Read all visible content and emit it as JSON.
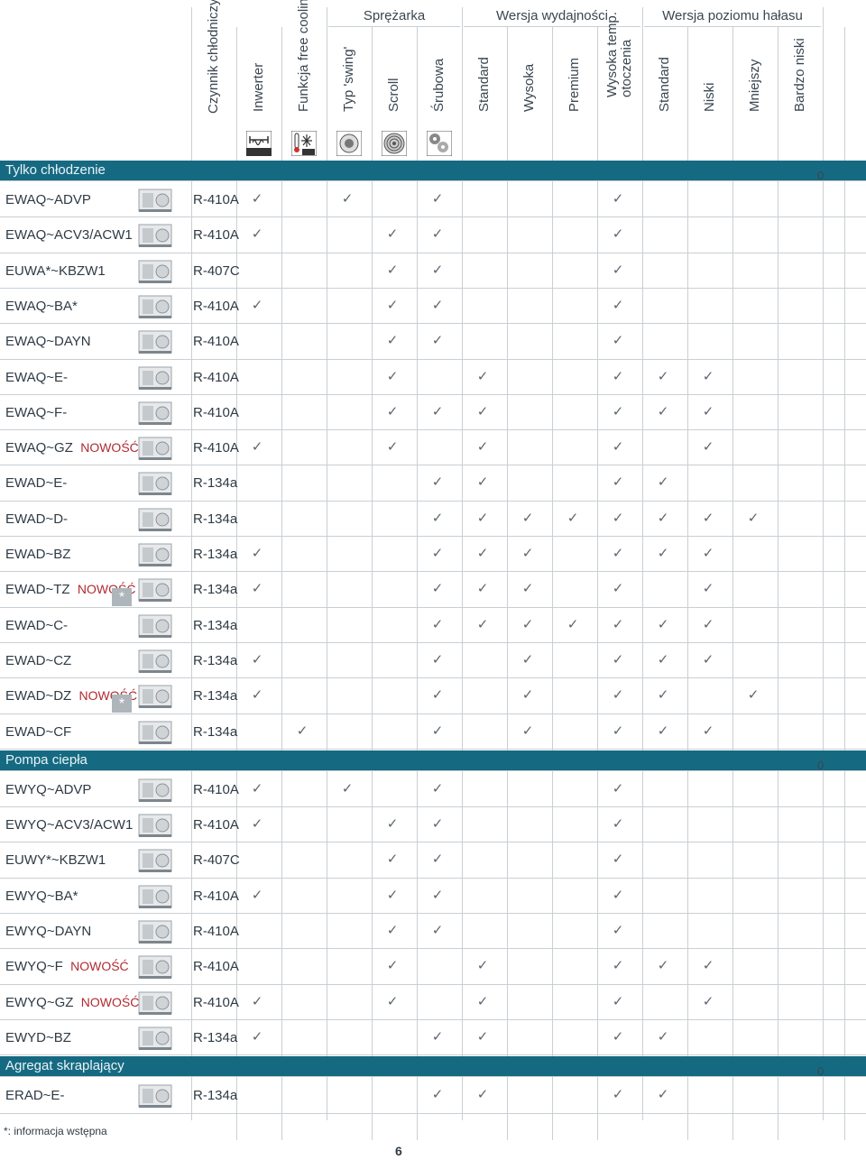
{
  "header": {
    "groups": [
      {
        "label": "Sprężarka"
      },
      {
        "label": "Wersja wydajności"
      },
      {
        "label": "Wersja poziomu hałasu"
      }
    ],
    "columns": [
      {
        "label": "Czynnik chłodniczy",
        "icon": ""
      },
      {
        "label": "Inwerter",
        "icon": "inverter-icon"
      },
      {
        "label": "Funkcja free cooling",
        "icon": "free-cooling-icon"
      },
      {
        "label": "Typ 'swing'",
        "icon": "swing-compressor-icon"
      },
      {
        "label": "Scroll",
        "icon": "scroll-compressor-icon"
      },
      {
        "label": "Śrubowa",
        "icon": "screw-compressor-icon"
      },
      {
        "label": "Standard",
        "icon": ""
      },
      {
        "label": "Wysoka",
        "icon": ""
      },
      {
        "label": "Premium",
        "icon": ""
      },
      {
        "label": "Wysoka temp.",
        "label2": "otoczenia",
        "icon": ""
      },
      {
        "label": "Standard",
        "icon": ""
      },
      {
        "label": "Niski",
        "icon": ""
      },
      {
        "label": "Mniejszy",
        "icon": ""
      },
      {
        "label": "Bardzo niski",
        "icon": ""
      }
    ],
    "icon_text": {
      "inverter": "INVERTER",
      "free": "FREE"
    }
  },
  "sections": [
    {
      "title": "Tylko chłodzenie",
      "zero": "0",
      "rows": [
        {
          "name": "EWAQ~ADVP",
          "tag": "",
          "star": false,
          "refrigerant": "R-410A",
          "checks": [
            1,
            3,
            5,
            9
          ]
        },
        {
          "name": "EWAQ~ACV3/ACW1",
          "tag": "",
          "star": false,
          "refrigerant": "R-410A",
          "checks": [
            1,
            4,
            5,
            9
          ]
        },
        {
          "name": "EUWA*~KBZW1",
          "tag": "",
          "star": false,
          "refrigerant": "R-407C",
          "checks": [
            4,
            5,
            9
          ]
        },
        {
          "name": "EWAQ~BA*",
          "tag": "",
          "star": false,
          "refrigerant": "R-410A",
          "checks": [
            1,
            4,
            5,
            9
          ]
        },
        {
          "name": "EWAQ~DAYN",
          "tag": "",
          "star": false,
          "refrigerant": "R-410A",
          "checks": [
            4,
            5,
            9
          ]
        },
        {
          "name": "EWAQ~E-",
          "tag": "",
          "star": false,
          "refrigerant": "R-410A",
          "checks": [
            4,
            6,
            9,
            10,
            11
          ]
        },
        {
          "name": "EWAQ~F-",
          "tag": "",
          "star": false,
          "refrigerant": "R-410A",
          "checks": [
            4,
            5,
            6,
            9,
            10,
            11
          ]
        },
        {
          "name": "EWAQ~GZ",
          "tag": "NOWOŚĆ",
          "star": false,
          "refrigerant": "R-410A",
          "checks": [
            1,
            4,
            6,
            9,
            11
          ]
        },
        {
          "name": "EWAD~E-",
          "tag": "",
          "star": false,
          "refrigerant": "R-134a",
          "checks": [
            5,
            6,
            9,
            10
          ]
        },
        {
          "name": "EWAD~D-",
          "tag": "",
          "star": false,
          "refrigerant": "R-134a",
          "checks": [
            5,
            6,
            7,
            8,
            9,
            10,
            11,
            12
          ]
        },
        {
          "name": "EWAD~BZ",
          "tag": "",
          "star": false,
          "refrigerant": "R-134a",
          "checks": [
            1,
            5,
            6,
            7,
            9,
            10,
            11
          ]
        },
        {
          "name": "EWAD~TZ",
          "tag": "NOWOŚĆ",
          "star": true,
          "refrigerant": "R-134a",
          "checks": [
            1,
            5,
            6,
            7,
            9,
            11
          ]
        },
        {
          "name": "EWAD~C-",
          "tag": "",
          "star": false,
          "refrigerant": "R-134a",
          "checks": [
            5,
            6,
            7,
            8,
            9,
            10,
            11
          ]
        },
        {
          "name": "EWAD~CZ",
          "tag": "",
          "star": false,
          "refrigerant": "R-134a",
          "checks": [
            1,
            5,
            7,
            9,
            10,
            11
          ]
        },
        {
          "name": "EWAD~DZ",
          "tag": "NOWOŚĆ",
          "star": true,
          "refrigerant": "R-134a",
          "checks": [
            1,
            5,
            7,
            9,
            10,
            12
          ]
        },
        {
          "name": "EWAD~CF",
          "tag": "",
          "star": false,
          "refrigerant": "R-134a",
          "checks": [
            2,
            5,
            7,
            9,
            10,
            11
          ]
        }
      ]
    },
    {
      "title": "Pompa ciepła",
      "zero": "0",
      "rows": [
        {
          "name": "EWYQ~ADVP",
          "tag": "",
          "star": false,
          "refrigerant": "R-410A",
          "checks": [
            1,
            3,
            5,
            9
          ]
        },
        {
          "name": "EWYQ~ACV3/ACW1",
          "tag": "",
          "star": false,
          "refrigerant": "R-410A",
          "checks": [
            1,
            4,
            5,
            9
          ]
        },
        {
          "name": "EUWY*~KBZW1",
          "tag": "",
          "star": false,
          "refrigerant": "R-407C",
          "checks": [
            4,
            5,
            9
          ]
        },
        {
          "name": "EWYQ~BA*",
          "tag": "",
          "star": false,
          "refrigerant": "R-410A",
          "checks": [
            1,
            4,
            5,
            9
          ]
        },
        {
          "name": "EWYQ~DAYN",
          "tag": "",
          "star": false,
          "refrigerant": "R-410A",
          "checks": [
            4,
            5,
            9
          ]
        },
        {
          "name": "EWYQ~F",
          "tag": "NOWOŚĆ",
          "star": false,
          "refrigerant": "R-410A",
          "checks": [
            4,
            6,
            9,
            10,
            11
          ]
        },
        {
          "name": "EWYQ~GZ",
          "tag": "NOWOŚĆ",
          "star": false,
          "refrigerant": "R-410A",
          "checks": [
            1,
            4,
            6,
            9,
            11
          ]
        },
        {
          "name": "EWYD~BZ",
          "tag": "",
          "star": false,
          "refrigerant": "R-134a",
          "checks": [
            1,
            5,
            6,
            9,
            10
          ]
        }
      ]
    },
    {
      "title": "Agregat skraplający",
      "zero": "0",
      "rows": [
        {
          "name": "ERAD~E-",
          "tag": "",
          "star": false,
          "refrigerant": "R-134a",
          "checks": [
            5,
            6,
            9,
            10
          ]
        }
      ]
    }
  ],
  "check_glyph": "✓",
  "star_glyph": "*",
  "footnote": "*: informacja wstępna",
  "page_number": "6"
}
